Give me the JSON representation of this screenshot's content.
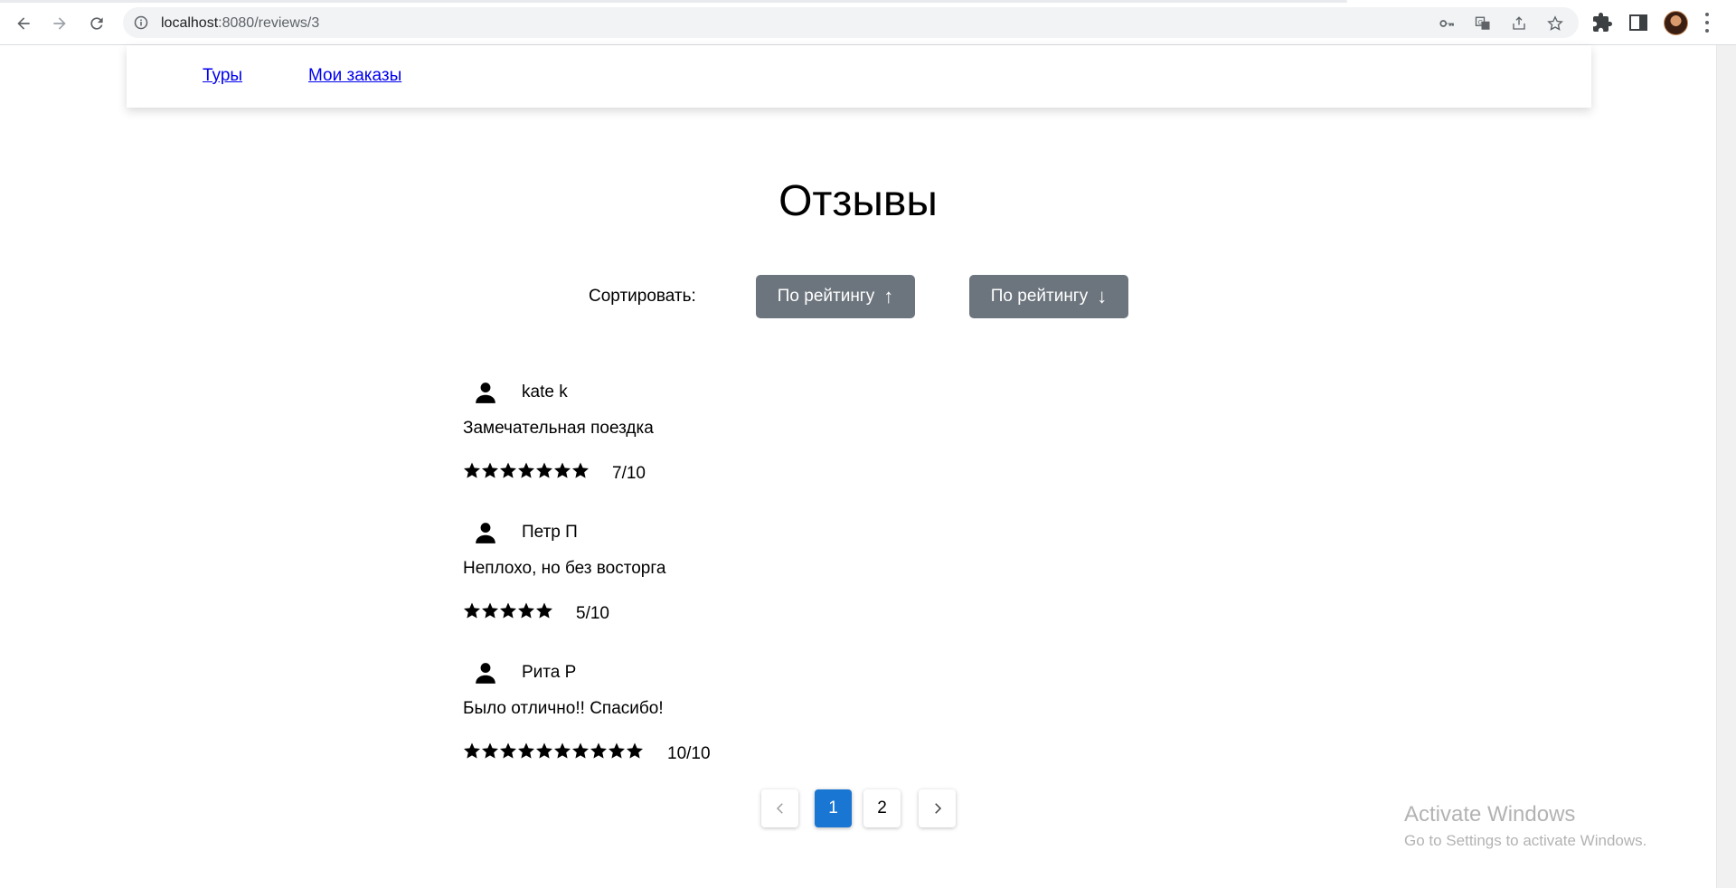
{
  "browser": {
    "url_host": "localhost",
    "url_path": ":8080/reviews/3"
  },
  "navbar": {
    "tours_label": "Туры",
    "orders_label": "Мои заказы"
  },
  "page": {
    "title": "Отзывы",
    "sort_label": "Сортировать:",
    "sort_asc_label": "По рейтингу",
    "sort_desc_label": "По рейтингу",
    "sort_asc_arrow": "↑",
    "sort_desc_arrow": "↓"
  },
  "reviews": [
    {
      "author": "kate k",
      "text": "Замечательная поездка",
      "stars": 7,
      "score": "7/10"
    },
    {
      "author": "Петр П",
      "text": "Неплохо, но без восторга",
      "stars": 5,
      "score": "5/10"
    },
    {
      "author": "Рита Р",
      "text": "Было отлично!! Спасибо!",
      "stars": 10,
      "score": "10/10"
    }
  ],
  "pagination": {
    "pages": [
      "1",
      "2"
    ],
    "active_page": "1"
  },
  "watermark": {
    "title": "Activate Windows",
    "subtitle": "Go to Settings to activate Windows."
  },
  "colors": {
    "sort_button_bg": "#6c757d",
    "active_page_bg": "#1976d2",
    "link": "#0000ee"
  }
}
